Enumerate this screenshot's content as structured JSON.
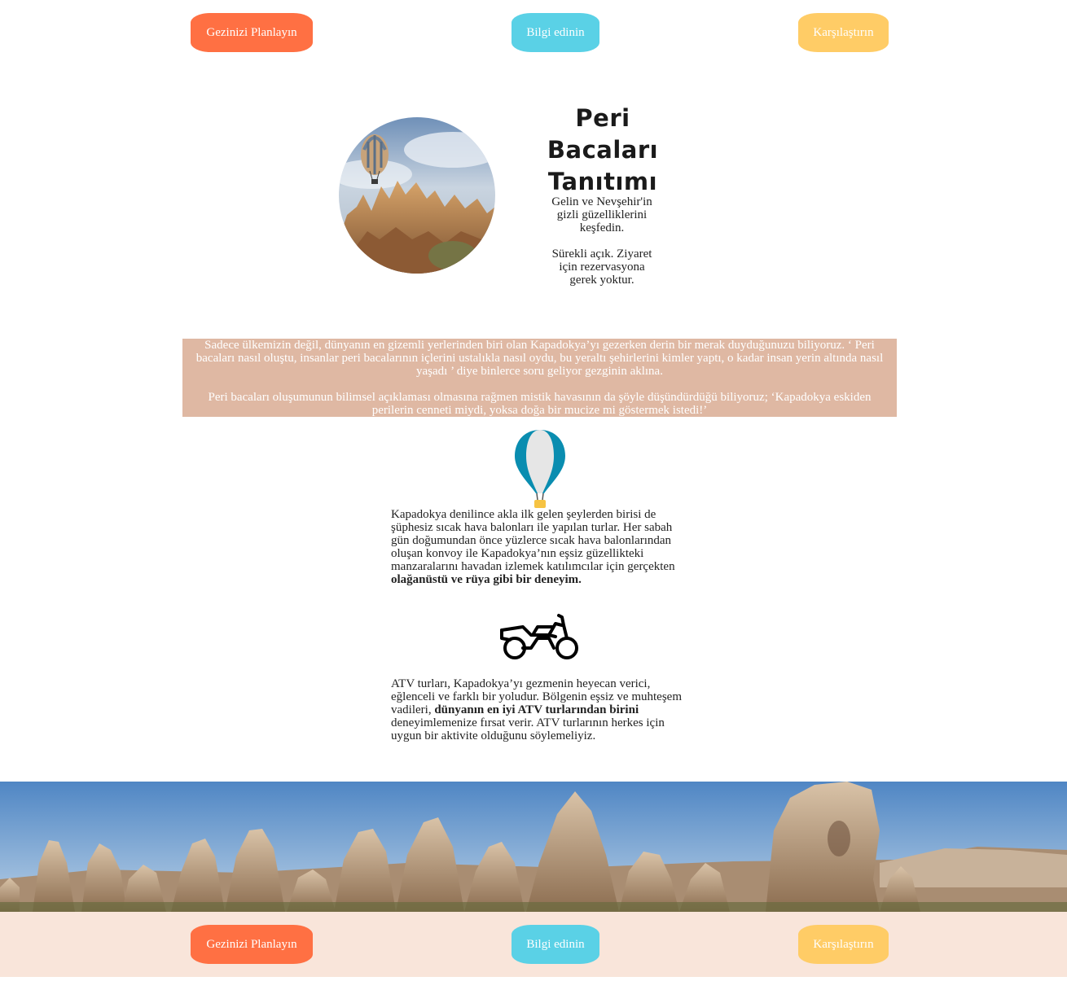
{
  "nav": {
    "plan_label": "Gezinizi Planlayın",
    "info_label": "Bilgi edinin",
    "compare_label": "Karşılaştırın"
  },
  "hero": {
    "title": "Peri Bacaları Tanıtımı",
    "text1": "Gelin ve Nevşehir'in gizli güzelliklerini keşfedin.",
    "text2": "Sürekli açık. Ziyaret için rezervasyona gerek yoktur."
  },
  "intro": {
    "p1": "Sadece ülkemizin değil, dünyanın en gizemli yerlerinden biri olan Kapadokya’yı gezerken derin bir merak duyduğunuzu biliyoruz. ‘ Peri bacaları nasıl oluştu, insanlar peri bacalarının içlerini ustalıkla nasıl oydu, bu yeraltı şehirlerini kimler yaptı, o kadar insan yerin altında nasıl yaşadı ’ diye binlerce soru geliyor gezginin aklına.",
    "p2": "Peri bacaları oluşumunun bilimsel açıklaması olmasına rağmen mistik havasının da şöyle düşündürdüğü biliyoruz; ‘Kapadokya eskiden perilerin cenneti miydi, yoksa doğa bir mucize mi göstermek istedi!’"
  },
  "balloon": {
    "icon": "hot-air-balloon-icon",
    "text": "Kapadokya denilince akla ilk gelen şeylerden birisi de şüphesiz sıcak hava balonları ile yapılan turlar. Her sabah gün doğumundan önce yüzlerce sıcak hava balonlarından oluşan konvoy ile Kapadokya’nın eşsiz güzellikteki manzaralarını havadan izlemek katılımcılar için gerçekten ",
    "bold": "olağanüstü ve rüya gibi bir deneyim."
  },
  "atv": {
    "icon": "motorcycle-icon",
    "text_before": "ATV turları, Kapadokya’yı gezmenin heyecan verici, eğlenceli ve farklı bir yoludur. Bölgenin eşsiz ve muhteşem vadileri, ",
    "bold": "dünyanın en iyi ATV turlarından birini",
    "text_after": " deneyimlemenize fırsat verir. ATV turlarının herkes için uygun bir aktivite olduğunu söylemeliyiz."
  },
  "colors": {
    "orange": "#ff7043",
    "blue": "#5ad1e6",
    "yellow": "#ffcc66",
    "intro_band": "#dfb8a3",
    "footer_band": "#f9e5da"
  }
}
